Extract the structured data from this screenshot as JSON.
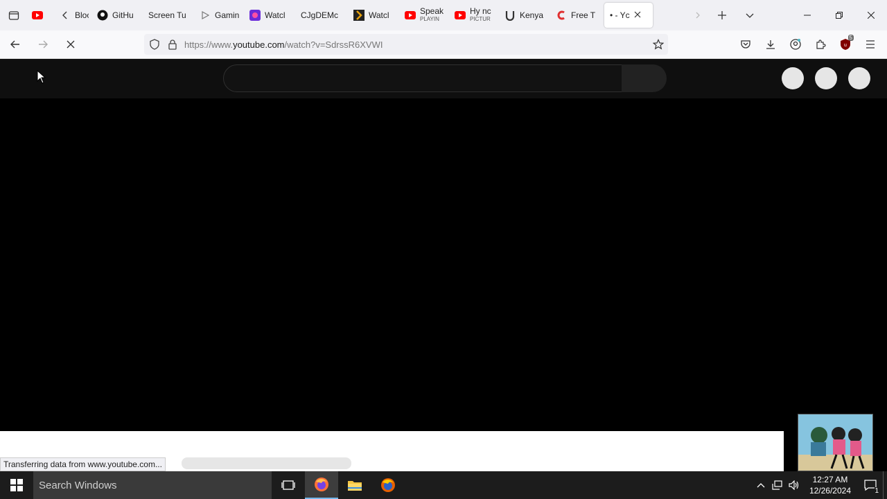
{
  "browser": {
    "tabs": [
      {
        "title": "",
        "icon": "youtube-icon"
      },
      {
        "title": "Bloc",
        "icon": "chevron-left-icon"
      },
      {
        "title": "GitHu",
        "icon": "github-icon"
      },
      {
        "title": "Screen Tu",
        "icon": ""
      },
      {
        "title": "Gamin",
        "icon": "play-outline-icon"
      },
      {
        "title": "Watcl",
        "icon": "purple-app-icon"
      },
      {
        "title": "CJgDEMc",
        "icon": ""
      },
      {
        "title": "Watcl",
        "icon": "plex-icon"
      },
      {
        "title": "Speak",
        "subtitle": "PLAYIN",
        "icon": "youtube-icon"
      },
      {
        "title": "Hy nc",
        "subtitle": "PICTUR",
        "icon": "youtube-icon"
      },
      {
        "title": "Kenya",
        "icon": "u-icon"
      },
      {
        "title": "Free T",
        "icon": "red-c-icon"
      },
      {
        "title": "• - Yc",
        "icon": "",
        "active": true
      }
    ],
    "url_prefix": "https://www.",
    "url_domain": "youtube.com",
    "url_path": "/watch?v=SdrssR6XVWI",
    "extension_badge": "5",
    "status_text": "Transferring data from www.youtube.com..."
  },
  "taskbar": {
    "search_placeholder": "Search Windows",
    "time": "12:27 AM",
    "date": "12/26/2024",
    "notification_count": "1"
  },
  "colors": {
    "youtube_red": "#ff0000",
    "page_bg": "#000000",
    "taskbar_bg": "#1c1c1c"
  }
}
